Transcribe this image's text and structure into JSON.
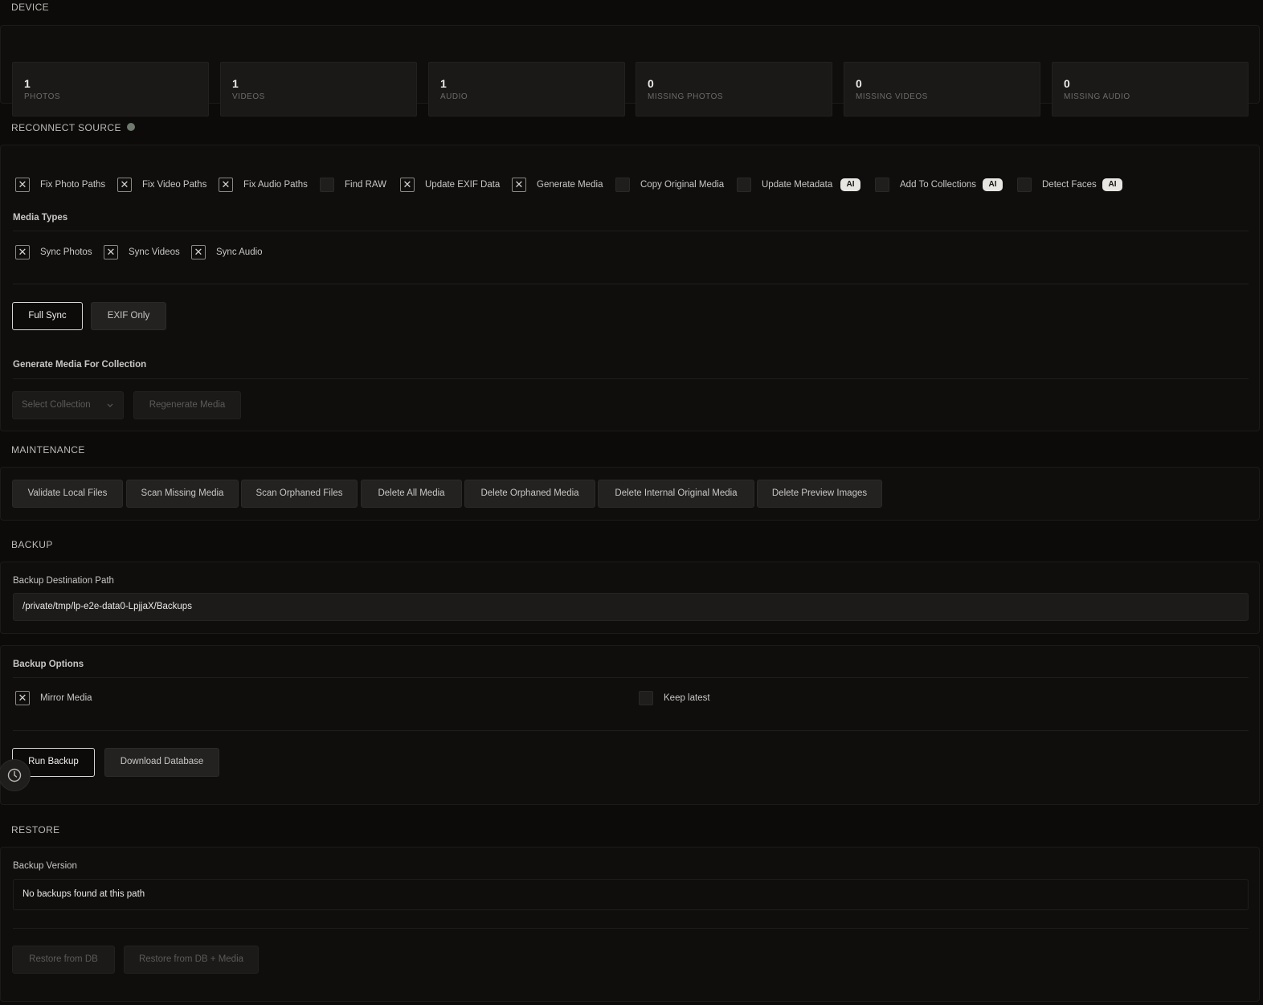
{
  "device": {
    "title": "DEVICE",
    "stats": [
      {
        "value": "1",
        "label": "PHOTOS"
      },
      {
        "value": "1",
        "label": "VIDEOS"
      },
      {
        "value": "1",
        "label": "AUDIO"
      },
      {
        "value": "0",
        "label": "MISSING PHOTOS"
      },
      {
        "value": "0",
        "label": "MISSING VIDEOS"
      },
      {
        "value": "0",
        "label": "MISSING AUDIO"
      }
    ]
  },
  "reconnect": {
    "title": "RECONNECT SOURCE",
    "options": [
      {
        "label": "Fix Photo Paths",
        "checked": true
      },
      {
        "label": "Fix Video Paths",
        "checked": true
      },
      {
        "label": "Fix Audio Paths",
        "checked": true
      },
      {
        "label": "Find RAW",
        "checked": false
      },
      {
        "label": "Update EXIF Data",
        "checked": true
      },
      {
        "label": "Generate Media",
        "checked": true
      },
      {
        "label": "Copy Original Media",
        "checked": false
      },
      {
        "label": "Update Metadata",
        "checked": false,
        "badge": "AI"
      },
      {
        "label": "Add To Collections",
        "checked": false,
        "badge": "AI"
      },
      {
        "label": "Detect Faces",
        "checked": false,
        "badge": "AI"
      }
    ],
    "media_types_title": "Media Types",
    "media_types": [
      {
        "label": "Sync Photos",
        "checked": true
      },
      {
        "label": "Sync Videos",
        "checked": true
      },
      {
        "label": "Sync Audio",
        "checked": true
      }
    ],
    "full_sync_label": "Full Sync",
    "exif_only_label": "EXIF Only",
    "generate_title": "Generate Media For Collection",
    "select_collection_placeholder": "Select Collection",
    "regenerate_label": "Regenerate Media"
  },
  "maintenance": {
    "title": "MAINTENANCE",
    "buttons": [
      "Validate Local Files",
      "Scan Missing Media",
      "Scan Orphaned Files",
      "Delete All Media",
      "Delete Orphaned Media",
      "Delete Internal Original Media",
      "Delete Preview Images"
    ]
  },
  "backup": {
    "title": "BACKUP",
    "dest_label": "Backup Destination Path",
    "dest_value": "/private/tmp/lp-e2e-data0-LpjjaX/Backups",
    "options_title": "Backup Options",
    "mirror_label": "Mirror Media",
    "mirror_checked": true,
    "keep_latest_label": "Keep latest",
    "keep_latest_checked": false,
    "run_label": "Run Backup",
    "download_label": "Download Database"
  },
  "restore": {
    "title": "RESTORE",
    "version_label": "Backup Version",
    "version_value": "No backups found at this path",
    "restore_db_label": "Restore from DB",
    "restore_db_media_label": "Restore from DB + Media"
  },
  "icons": {
    "checkbox_checked": "x-mark-icon",
    "clock": "clock-icon",
    "dropdown": "chevron-down-icon"
  }
}
